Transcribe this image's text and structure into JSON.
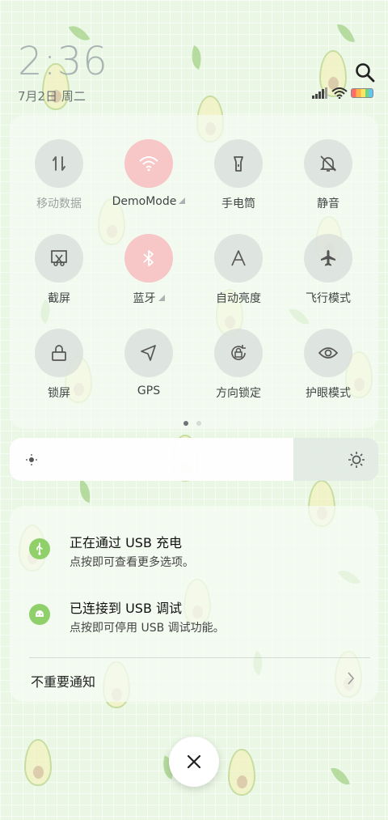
{
  "status_bar": {
    "time": "2:36",
    "date": "7月2日 周二",
    "battery_colors": [
      "#ff6b6b",
      "#ffb347",
      "#f5e663",
      "#6fd38a",
      "#5cc6ff"
    ]
  },
  "search": {
    "icon": "search-icon"
  },
  "quick_settings": [
    {
      "id": "mobile-data",
      "label": "移动数据",
      "icon": "mobile-data-icon",
      "active": false,
      "disabled": true,
      "has_menu": false
    },
    {
      "id": "wifi",
      "label": "DemoMode",
      "icon": "wifi-icon",
      "active": true,
      "disabled": false,
      "has_menu": true
    },
    {
      "id": "flashlight",
      "label": "手电筒",
      "icon": "flashlight-icon",
      "active": false,
      "disabled": false,
      "has_menu": false
    },
    {
      "id": "mute",
      "label": "静音",
      "icon": "bell-off-icon",
      "active": false,
      "disabled": false,
      "has_menu": false
    },
    {
      "id": "screenshot",
      "label": "截屏",
      "icon": "screenshot-icon",
      "active": false,
      "disabled": false,
      "has_menu": false
    },
    {
      "id": "bluetooth",
      "label": "蓝牙",
      "icon": "bluetooth-icon",
      "active": true,
      "disabled": false,
      "has_menu": true
    },
    {
      "id": "auto-brightness",
      "label": "自动亮度",
      "icon": "auto-brightness-icon",
      "active": false,
      "disabled": false,
      "has_menu": false
    },
    {
      "id": "airplane",
      "label": "飞行模式",
      "icon": "airplane-icon",
      "active": false,
      "disabled": false,
      "has_menu": false
    },
    {
      "id": "lock-screen",
      "label": "锁屏",
      "icon": "lock-icon",
      "active": false,
      "disabled": false,
      "has_menu": false
    },
    {
      "id": "gps",
      "label": "GPS",
      "icon": "location-arrow-icon",
      "active": false,
      "disabled": false,
      "has_menu": false
    },
    {
      "id": "rotation-lock",
      "label": "方向锁定",
      "icon": "rotation-lock-icon",
      "active": false,
      "disabled": false,
      "has_menu": false
    },
    {
      "id": "eye-care",
      "label": "护眼模式",
      "icon": "eye-icon",
      "active": false,
      "disabled": false,
      "has_menu": false
    }
  ],
  "page_indicator": {
    "current": 1,
    "total": 2
  },
  "brightness": {
    "level": 0.77
  },
  "notifications": [
    {
      "title": "正在通过 USB 充电",
      "subtitle": "点按即可查看更多选项。",
      "icon": "usb-icon"
    },
    {
      "title": "已连接到 USB 调试",
      "subtitle": "点按即可停用 USB 调试功能。",
      "icon": "android-debug-icon"
    }
  ],
  "unimportant_label": "不重要通知",
  "close": {
    "icon": "close-icon"
  },
  "colors": {
    "active_tile": "#f7c6c6",
    "tile": "#d8deda",
    "accent": "#8fd06a"
  }
}
